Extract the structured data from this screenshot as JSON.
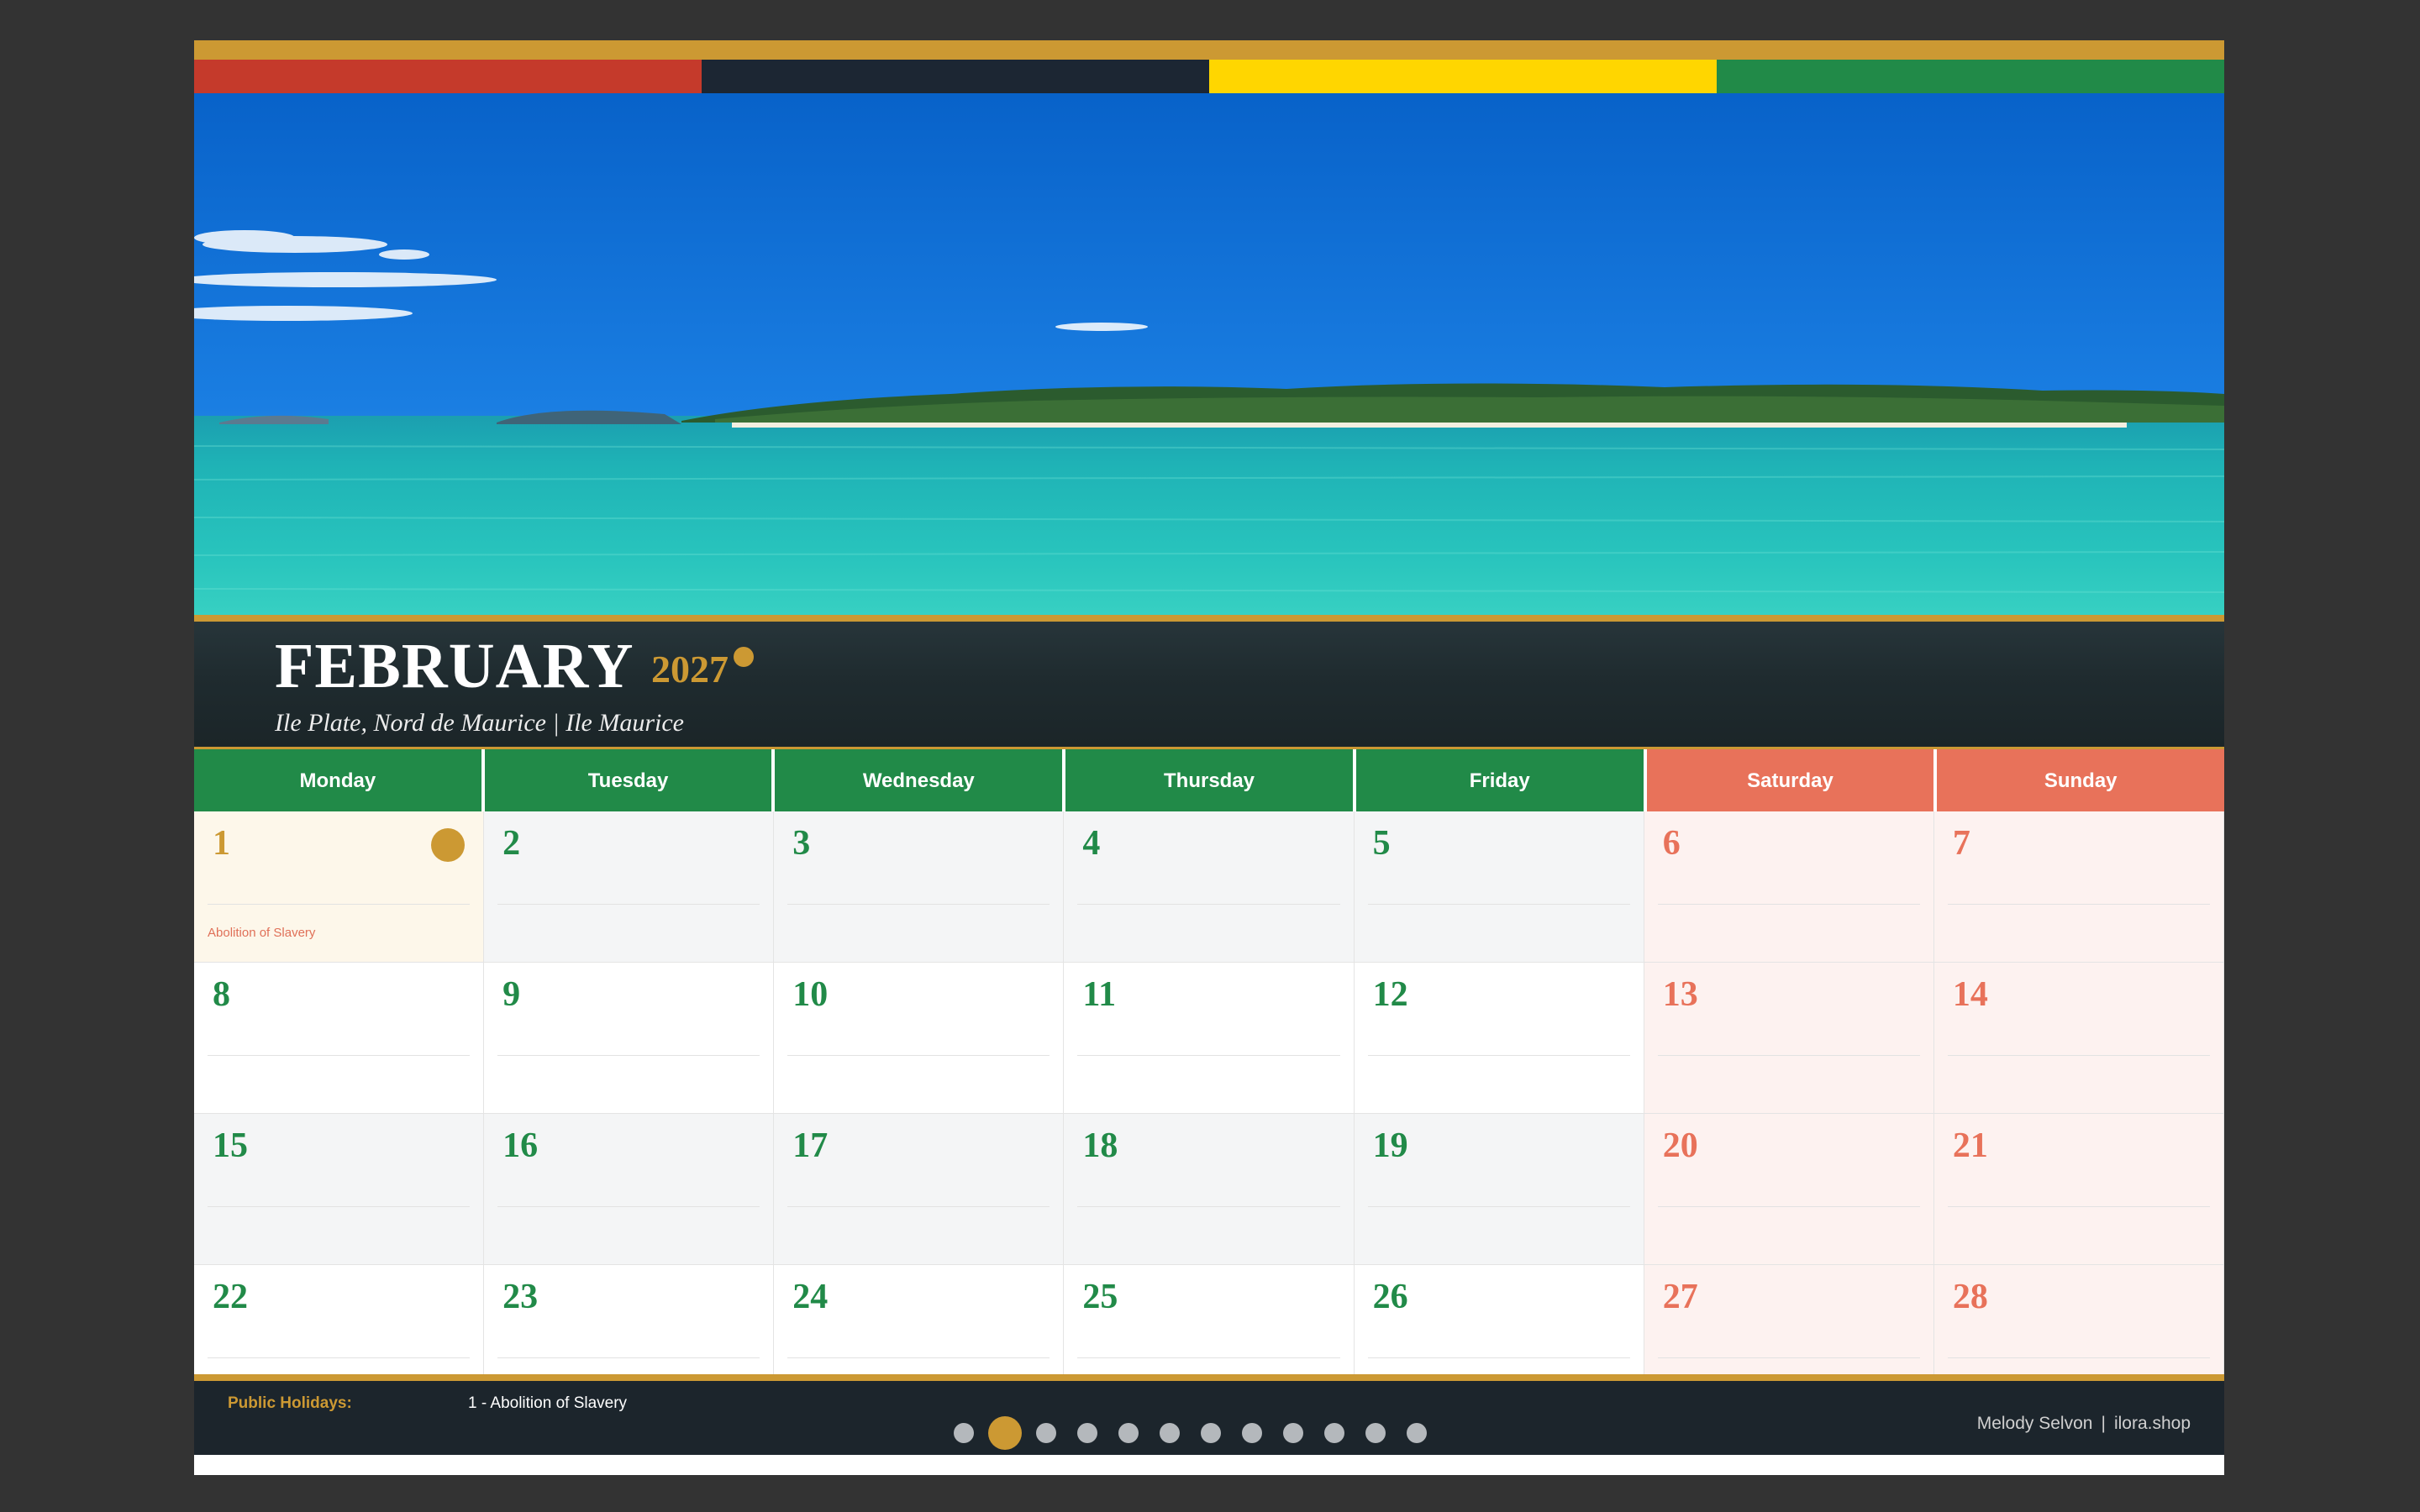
{
  "calendar": {
    "month": "FEBRUARY",
    "year": "2027",
    "location": "Ile Plate, Nord de Maurice  |  Ile Maurice",
    "flag_colors": [
      "#c53a2b",
      "#1c2633",
      "#ffd600",
      "#218a48"
    ],
    "accent_color": "#cc9933",
    "weekday_color": "#218a48",
    "weekend_color": "#e8725a",
    "weekdays": [
      {
        "label": "Monday",
        "weekend": false
      },
      {
        "label": "Tuesday",
        "weekend": false
      },
      {
        "label": "Wednesday",
        "weekend": false
      },
      {
        "label": "Thursday",
        "weekend": false
      },
      {
        "label": "Friday",
        "weekend": false
      },
      {
        "label": "Saturday",
        "weekend": true
      },
      {
        "label": "Sunday",
        "weekend": true
      }
    ],
    "weeks": [
      [
        {
          "day": "1",
          "holiday": "Abolition of Slavery"
        },
        {
          "day": "2"
        },
        {
          "day": "3"
        },
        {
          "day": "4"
        },
        {
          "day": "5"
        },
        {
          "day": "6"
        },
        {
          "day": "7"
        }
      ],
      [
        {
          "day": "8"
        },
        {
          "day": "9"
        },
        {
          "day": "10"
        },
        {
          "day": "11"
        },
        {
          "day": "12"
        },
        {
          "day": "13"
        },
        {
          "day": "14"
        }
      ],
      [
        {
          "day": "15"
        },
        {
          "day": "16"
        },
        {
          "day": "17"
        },
        {
          "day": "18"
        },
        {
          "day": "19"
        },
        {
          "day": "20"
        },
        {
          "day": "21"
        }
      ],
      [
        {
          "day": "22"
        },
        {
          "day": "23"
        },
        {
          "day": "24"
        },
        {
          "day": "25"
        },
        {
          "day": "26"
        },
        {
          "day": "27"
        },
        {
          "day": "28"
        }
      ]
    ]
  },
  "footer": {
    "holidays_label": "Public Holidays:",
    "holidays_value": "1 - Abolition of Slavery",
    "credit_name": "Melody Selvon",
    "credit_separator": "|",
    "credit_site": "ilora.shop"
  },
  "pagination": {
    "total": 12,
    "current": 2
  }
}
